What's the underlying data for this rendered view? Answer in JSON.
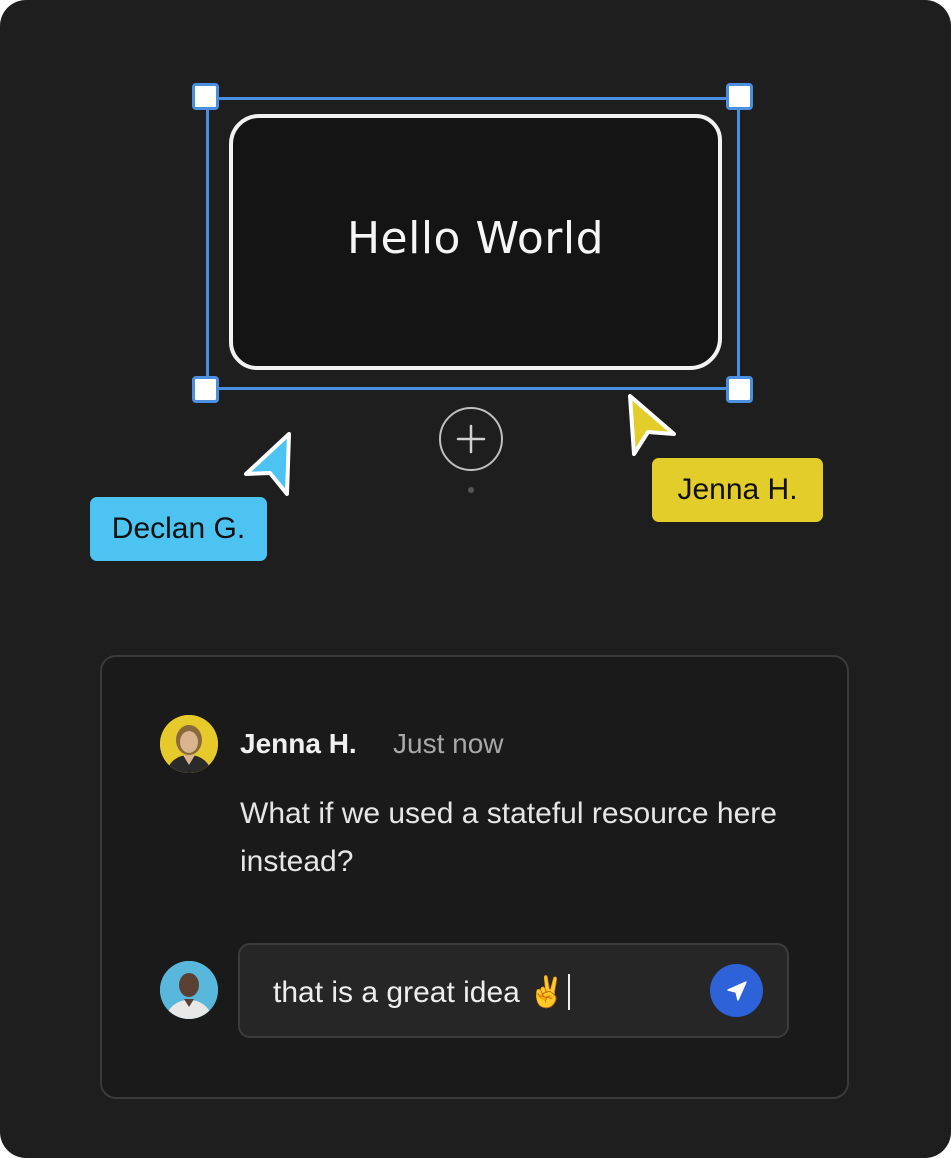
{
  "canvas": {
    "node_text": "Hello World",
    "accent_color": "#4a8fe0"
  },
  "collaborators": {
    "declan": {
      "name": "Declan G.",
      "color": "#4cc3f0"
    },
    "jenna": {
      "name": "Jenna H.",
      "color": "#e3cd2a"
    }
  },
  "comment": {
    "author": "Jenna H.",
    "timestamp": "Just now",
    "body": "What if we used a stateful resource here instead?"
  },
  "reply": {
    "value": "that is a great idea ✌️",
    "send_color": "#2d62d8"
  },
  "icons": {
    "add": "plus-circle-icon",
    "send": "send-arrow-icon",
    "cursor": "pointer-cursor-icon"
  }
}
